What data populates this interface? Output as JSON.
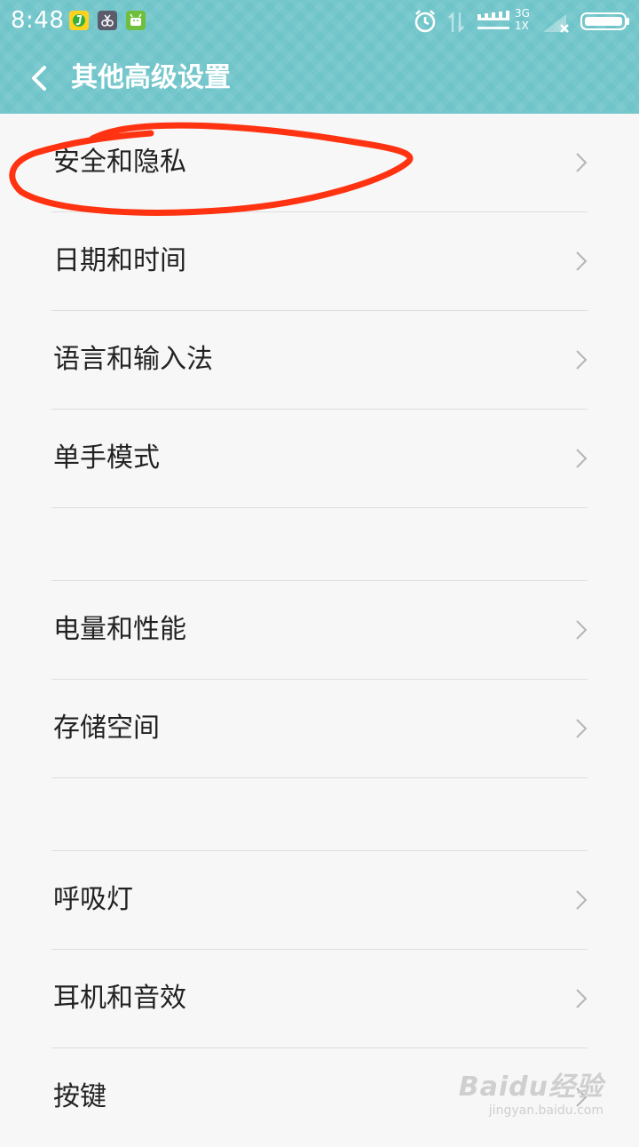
{
  "status_bar": {
    "time": "8:48",
    "network_label": "3G",
    "network_label2": "1X"
  },
  "header": {
    "title": "其他高级设置"
  },
  "settings_items": [
    {
      "label": "安全和隐私"
    },
    {
      "label": "日期和时间"
    },
    {
      "label": "语言和输入法"
    },
    {
      "label": "单手模式"
    },
    {
      "label": "电量和性能"
    },
    {
      "label": "存储空间"
    },
    {
      "label": "呼吸灯"
    },
    {
      "label": "耳机和音效"
    },
    {
      "label": "按键"
    }
  ],
  "watermark": {
    "main": "Baidu经验",
    "sub": "jingyan.baidu.com"
  },
  "colors": {
    "header": "#6ec4c9",
    "annotation": "#ff3311"
  }
}
